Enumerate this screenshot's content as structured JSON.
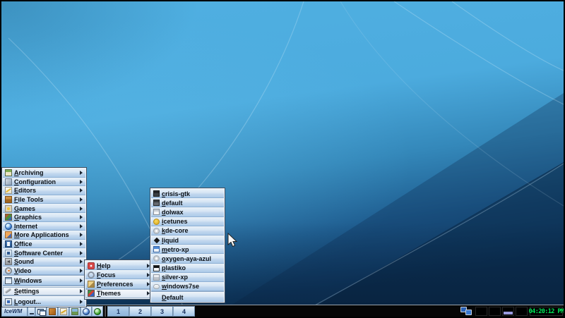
{
  "menus": {
    "main": {
      "items": [
        {
          "label": "Archiving",
          "icon": "archiving",
          "submenu": true
        },
        {
          "label": "Configuration",
          "icon": "configuration",
          "submenu": true
        },
        {
          "label": "Editors",
          "icon": "editors",
          "submenu": true
        },
        {
          "label": "File Tools",
          "icon": "file-tools",
          "submenu": true
        },
        {
          "label": "Games",
          "icon": "games",
          "submenu": true
        },
        {
          "label": "Graphics",
          "icon": "graphics",
          "submenu": true
        },
        {
          "label": "Internet",
          "icon": "internet",
          "submenu": true
        },
        {
          "label": "More Applications",
          "icon": "more-applications",
          "submenu": true
        },
        {
          "label": "Office",
          "icon": "office",
          "submenu": true
        },
        {
          "label": "Software Center",
          "icon": "software-center",
          "submenu": true
        },
        {
          "label": "Sound",
          "icon": "sound",
          "submenu": true
        },
        {
          "label": "Video",
          "icon": "video",
          "submenu": true
        },
        {
          "label": "Windows",
          "icon": "windows",
          "submenu": true,
          "separator_before": true
        },
        {
          "label": "Settings",
          "icon": "settings",
          "submenu": true,
          "separator_before": true,
          "selected": true
        },
        {
          "label": "Logout...",
          "icon": "logout",
          "submenu": true,
          "separator_before": true
        }
      ]
    },
    "settings": {
      "items": [
        {
          "label": "Help",
          "icon": "help",
          "submenu": true
        },
        {
          "label": "Focus",
          "icon": "focus",
          "submenu": true
        },
        {
          "label": "Preferences",
          "icon": "preferences",
          "submenu": true
        },
        {
          "label": "Themes",
          "icon": "themes",
          "submenu": true,
          "selected": true
        }
      ]
    },
    "themes": {
      "items": [
        {
          "label": "crisis-gtk",
          "icon": "theme-dark",
          "submenu": false
        },
        {
          "label": "default",
          "icon": "theme-dark2",
          "submenu": false
        },
        {
          "label": "dolwax",
          "icon": "theme-light",
          "submenu": false
        },
        {
          "label": "icetunes",
          "icon": "theme-yellow",
          "submenu": false
        },
        {
          "label": "kde-core",
          "icon": "theme-ring",
          "submenu": false
        },
        {
          "label": "liquid",
          "icon": "theme-diamond",
          "submenu": false
        },
        {
          "label": "metro-xp",
          "icon": "theme-blue",
          "submenu": false
        },
        {
          "label": "oxygen-aya-azul",
          "icon": "theme-ring2",
          "submenu": false
        },
        {
          "label": "plastiko",
          "icon": "theme-bw",
          "submenu": false
        },
        {
          "label": "silver-xp",
          "icon": "theme-silver",
          "submenu": false
        },
        {
          "label": "windows7se",
          "icon": "theme-pill",
          "submenu": false
        },
        {
          "label": "Default",
          "icon": "none",
          "submenu": false,
          "separator_before": true
        }
      ]
    }
  },
  "taskbar": {
    "start_label": "IceWM",
    "launchers": [
      {
        "icon": "package"
      },
      {
        "icon": "editor"
      },
      {
        "icon": "image"
      },
      {
        "icon": "browser"
      },
      {
        "icon": "globe-green"
      }
    ],
    "workspaces": [
      {
        "text": "1",
        "active": true
      },
      {
        "text": "2",
        "active": false
      },
      {
        "text": "3",
        "active": false
      },
      {
        "text": "4",
        "active": false
      }
    ],
    "clock": "04:20:12 PM"
  }
}
